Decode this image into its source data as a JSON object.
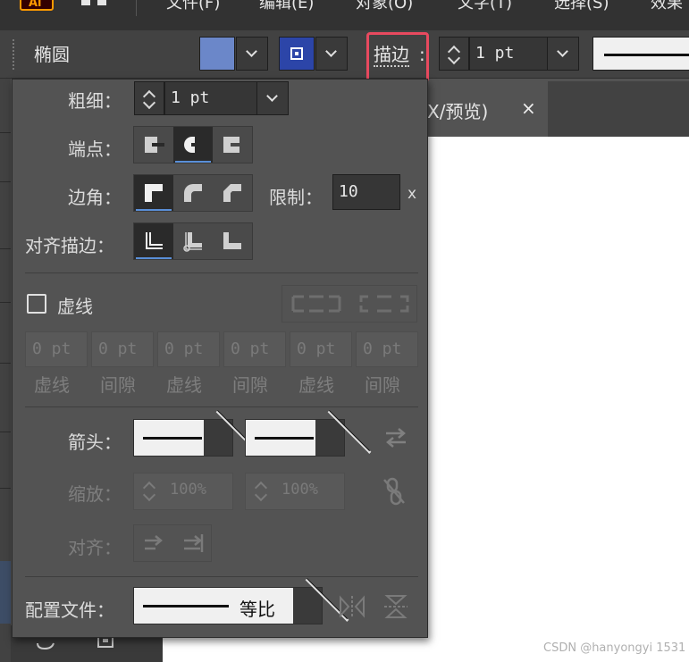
{
  "menubar": {
    "logo": "Ai",
    "items": [
      "文件(F)",
      "编辑(E)",
      "对象(O)",
      "文字(T)",
      "选择(S)",
      "效果"
    ]
  },
  "controlbar": {
    "object_type": "椭圆",
    "stroke_link_label": "描边",
    "stroke_link_colon": ":",
    "stroke_weight": "1 pt",
    "fill_color": "#6b87c9",
    "stroke_color": "#2c45a8"
  },
  "document_tab": {
    "title": "X/预览)",
    "close": "×"
  },
  "panel": {
    "weight_label": "粗细：",
    "weight_value": "1 pt",
    "cap_label": "端点：",
    "corner_label": "边角：",
    "limit_label": "限制：",
    "limit_value": "10",
    "limit_unit": "x",
    "align_label": "对齐描边：",
    "dashed_label": "虚线",
    "dash_values": [
      "0 pt",
      "0 pt",
      "0 pt",
      "0 pt",
      "0 pt",
      "0 pt"
    ],
    "dash_captions": [
      "虚线",
      "间隙",
      "虚线",
      "间隙",
      "虚线",
      "间隙"
    ],
    "arrow_label": "箭头：",
    "scale_label": "缩放：",
    "scale_start": "100%",
    "scale_end": "100%",
    "align_arrow_label": "对齐：",
    "profile_label": "配置文件：",
    "profile_value": "等比"
  },
  "watermark": "CSDN @hanyongyi 1531",
  "colors": {
    "highlight_border": "#e84a5f",
    "selected_underline": "#5a8fd8"
  }
}
